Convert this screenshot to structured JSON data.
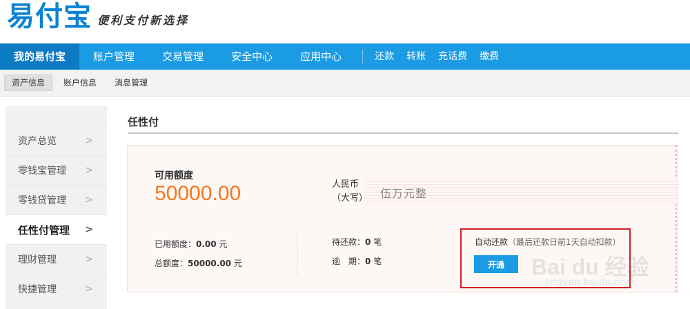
{
  "header": {
    "logo_text": "易付宝",
    "slogan": "便利支付新选择"
  },
  "main_nav": {
    "items": [
      {
        "label": "我的易付宝",
        "active": true
      },
      {
        "label": "账户管理"
      },
      {
        "label": "交易管理"
      },
      {
        "label": "安全中心"
      },
      {
        "label": "应用中心"
      }
    ],
    "quick_links": [
      "还款",
      "转账",
      "充话费",
      "缴费"
    ]
  },
  "sub_nav": {
    "items": [
      {
        "label": "资产信息",
        "active": true
      },
      {
        "label": "账户信息"
      },
      {
        "label": "消息管理"
      }
    ]
  },
  "sidebar": {
    "items": [
      {
        "label": "资产总览"
      },
      {
        "label": "零钱宝管理"
      },
      {
        "label": "零钱贷管理"
      },
      {
        "label": "任性付管理",
        "active": true
      },
      {
        "label": "理财管理"
      },
      {
        "label": "快捷管理"
      }
    ],
    "chevron_icon": "chevron-right-icon"
  },
  "content": {
    "title": "任性付",
    "available_label": "可用额度",
    "available_value": "50000.00",
    "rmb_label_line1": "人民币",
    "rmb_label_line2": "（大写）",
    "rmb_uppercase": "伍万元整",
    "used_label": "已用额度：",
    "used_value": "0.00",
    "total_label": "总额度：",
    "total_value": "50000.00",
    "currency_unit": "元",
    "due_label": "待还款：",
    "due_value": "0",
    "overdue_label": "逾　期：",
    "overdue_value": "0",
    "count_unit": "笔",
    "auto_repay_label": "自动还款",
    "auto_repay_hint": "（最后还款日前1天自动扣款）",
    "open_button": "开通"
  },
  "watermark": {
    "text": "Bai du 经验",
    "sub": "jingyan.baidu.com"
  },
  "colors": {
    "nav_blue": "#1a9be4",
    "nav_active": "#0d7ac4",
    "amount_orange": "#f7771e",
    "highlight_red": "#d11f26",
    "logo_blue": "#0b83d4"
  }
}
